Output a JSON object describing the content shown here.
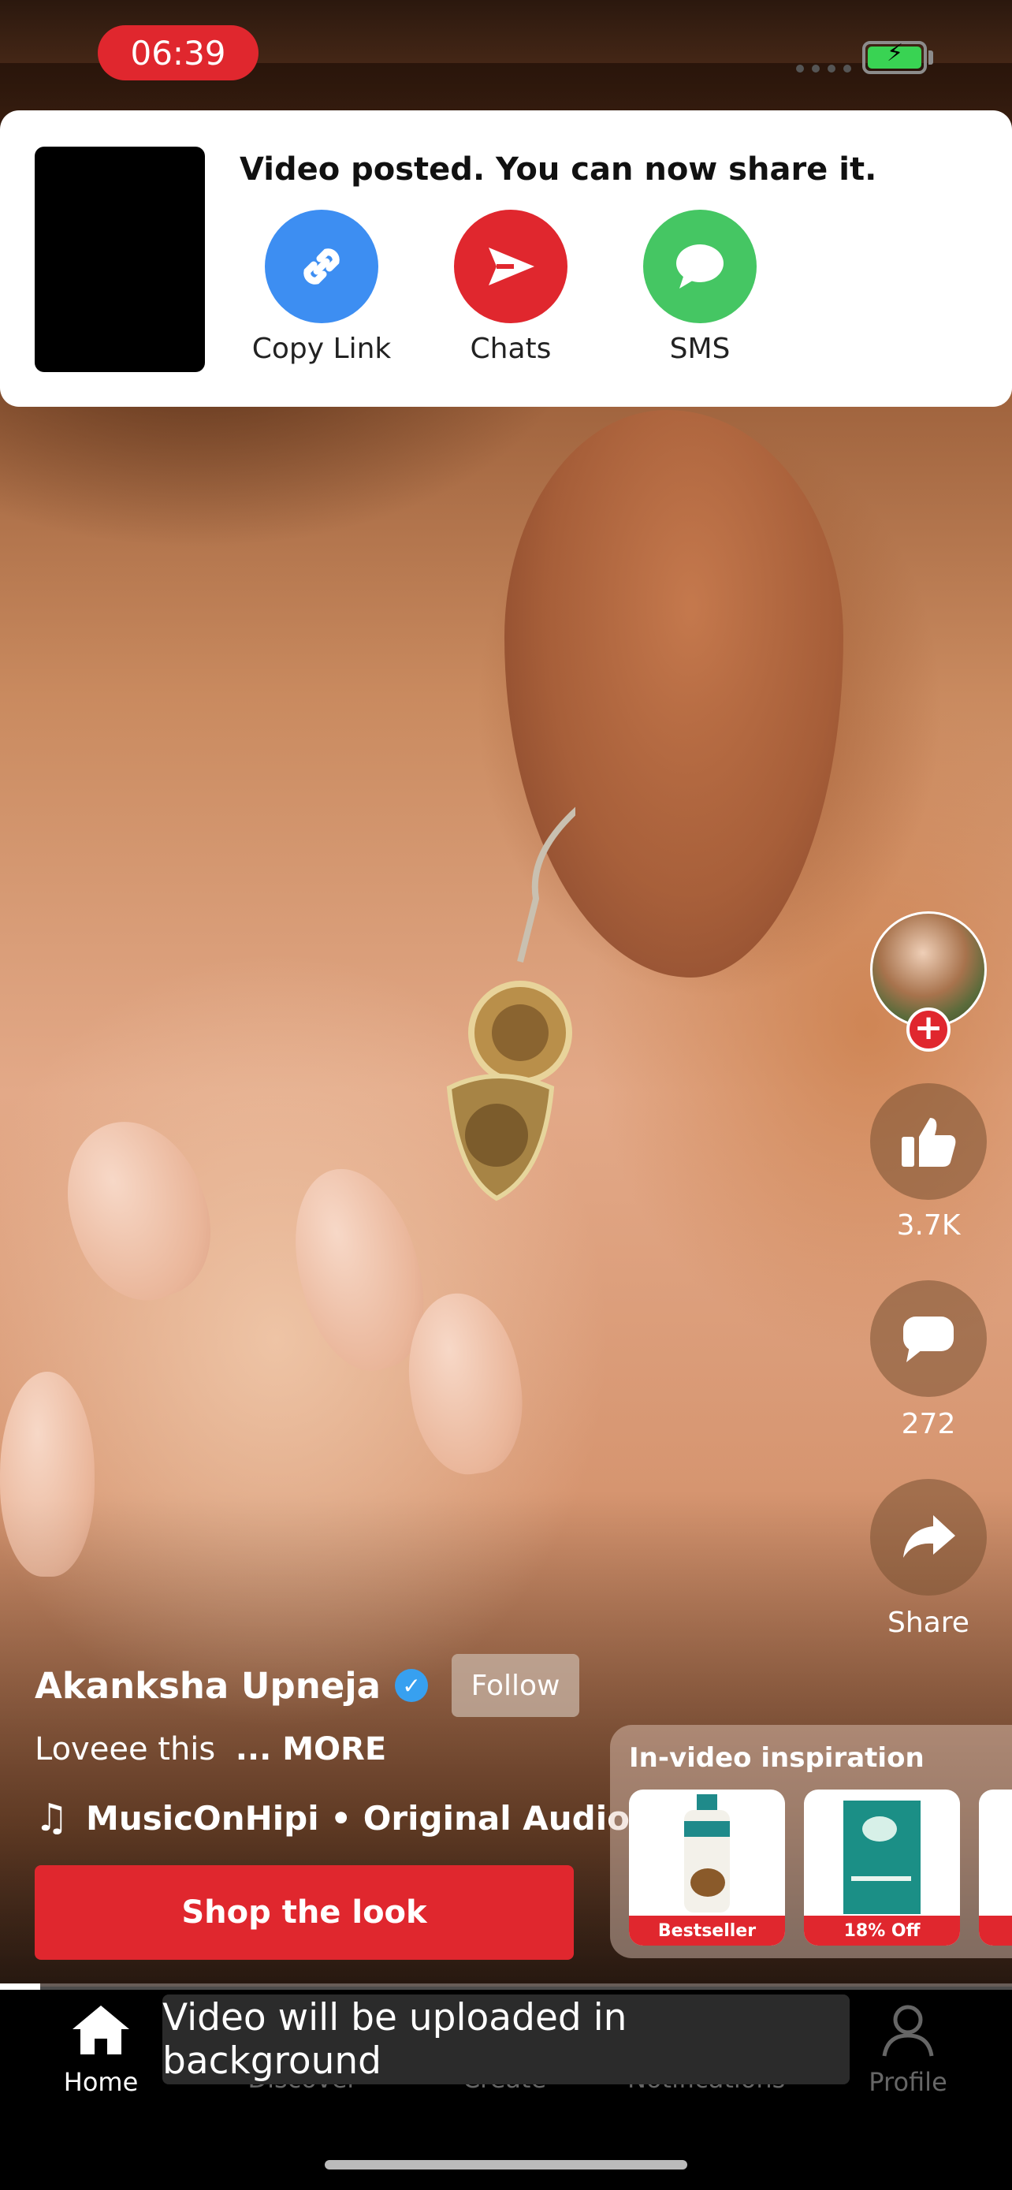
{
  "status_bar": {
    "time": "06:39"
  },
  "share_card": {
    "title": "Video posted. You can now share it.",
    "options": [
      {
        "label": "Copy Link",
        "icon": "link-icon",
        "color": "#3d8ef2"
      },
      {
        "label": "Chats",
        "icon": "send-icon",
        "color": "#e0272e"
      },
      {
        "label": "SMS",
        "icon": "sms-bubble-icon",
        "color": "#45c663"
      }
    ]
  },
  "rail": {
    "likes": "3.7K",
    "comments": "272",
    "share_label": "Share"
  },
  "creator": {
    "name": "Akanksha Upneja",
    "follow_label": "Follow"
  },
  "caption": {
    "text": "Loveee this",
    "more": "... MORE"
  },
  "audio": {
    "text": "MusicOnHipi • Original Audio"
  },
  "shop": {
    "label": "Shop the look"
  },
  "inspiration": {
    "title": "In-video inspiration",
    "products": [
      {
        "tag": "Bestseller"
      },
      {
        "tag": "18% Off"
      }
    ]
  },
  "video_progress": 0.04,
  "toast": {
    "text": "Video will be uploaded in background"
  },
  "nav": {
    "items": [
      {
        "label": "Home"
      },
      {
        "label": "Discover"
      },
      {
        "label": "Create"
      },
      {
        "label": "Notifications"
      },
      {
        "label": "Profile"
      }
    ]
  },
  "colors": {
    "accent": "#e0272e"
  }
}
